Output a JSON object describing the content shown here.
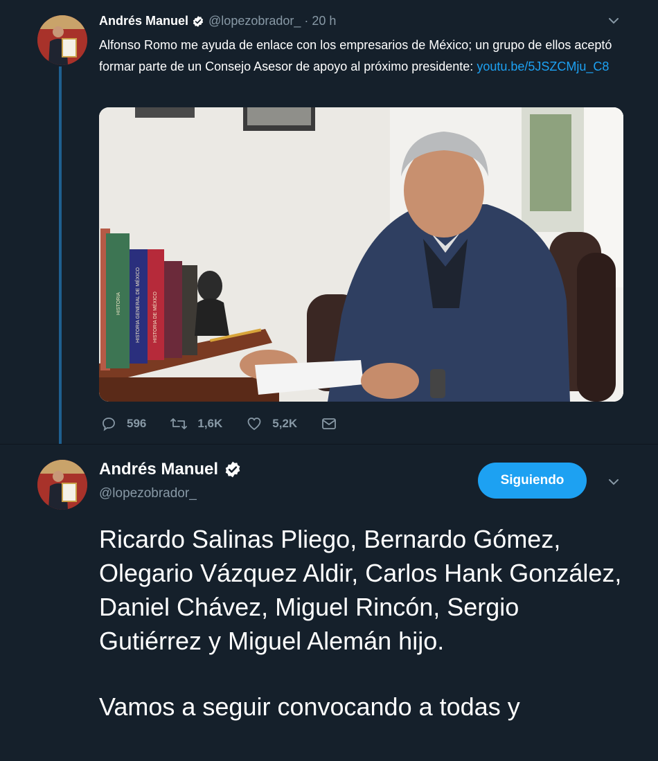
{
  "tweet1": {
    "author_name": "Andrés Manuel",
    "author_handle": "@lopezobrador_",
    "separator": "·",
    "time": "20 h",
    "text": "Alfonso Romo me ayuda de enlace con los empresarios de México; un grupo de ellos aceptó formar parte de un Consejo Asesor de apoyo al próximo presidente: ",
    "link": "youtu.be/5JSZCMju_C8",
    "replies": "596",
    "retweets": "1,6K",
    "likes": "5,2K",
    "media_book_spines": [
      "HISTORIA",
      "HISTORIA GENERAL DE MÉXICO",
      "HISTORIA DE MÉXICO"
    ]
  },
  "tweet2": {
    "author_name": "Andrés Manuel",
    "author_handle": "@lopezobrador_",
    "follow_label": "Siguiendo",
    "paragraph1": "Ricardo Salinas Pliego, Bernardo Gómez, Olegario Vázquez Aldir, Carlos Hank González, Daniel Chávez, Miguel Rincón, Sergio Gutiérrez y Miguel Alemán hijo.",
    "paragraph2": "Vamos a seguir convocando a todas y"
  },
  "icons": {
    "reply": "reply-icon",
    "retweet": "retweet-icon",
    "like": "heart-icon",
    "dm": "envelope-icon",
    "verified": "verified-badge-icon",
    "caret": "chevron-down-icon"
  },
  "colors": {
    "background": "#15202b",
    "accent": "#1da1f2",
    "secondary_text": "#8899a6",
    "thread_line": "#1f5f8f"
  }
}
